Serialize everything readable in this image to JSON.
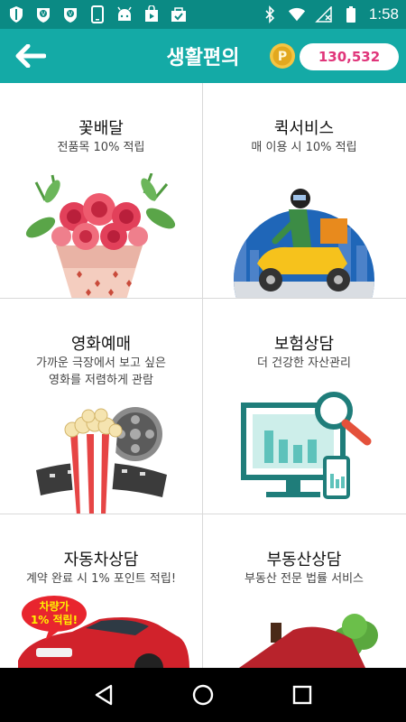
{
  "status_bar": {
    "time": "1:58",
    "icons": [
      "shield-icon",
      "badge-icon",
      "badge-icon",
      "phone-icon",
      "android-icon",
      "play-store-icon",
      "check-icon",
      "bluetooth-icon",
      "wifi-icon",
      "signal-off-icon",
      "battery-icon"
    ]
  },
  "app_bar": {
    "title": "생활편의",
    "points": "130,532",
    "coin_label": "P",
    "colors": {
      "background": "#14aaa6",
      "status": "#0b8a84",
      "points_text": "#e0357a"
    }
  },
  "tiles": [
    {
      "title": "꽃배달",
      "sub": "전품목  10% 적립",
      "art": "flower-bouquet-icon"
    },
    {
      "title": "퀵서비스",
      "sub": "매 이용 시 10% 적립",
      "art": "scooter-delivery-icon"
    },
    {
      "title": "영화예매",
      "sub": "가까운 극장에서 보고 싶은\n영화를 저렴하게 관람",
      "art": "popcorn-film-icon"
    },
    {
      "title": "보험상담",
      "sub": "더 건강한 자산관리",
      "art": "monitor-chart-icon"
    },
    {
      "title": "자동차상담",
      "sub": "계약 완료 시 1% 포인트 적립!",
      "art": "red-car-icon",
      "badge_line1": "차량가",
      "badge_line2": "1% 적립!"
    },
    {
      "title": "부동산상담",
      "sub": "부동산 전문 법률 서비스",
      "art": "house-icon"
    }
  ],
  "nav_bar": {
    "items": [
      "back-nav-icon",
      "home-nav-icon",
      "recents-nav-icon"
    ]
  }
}
